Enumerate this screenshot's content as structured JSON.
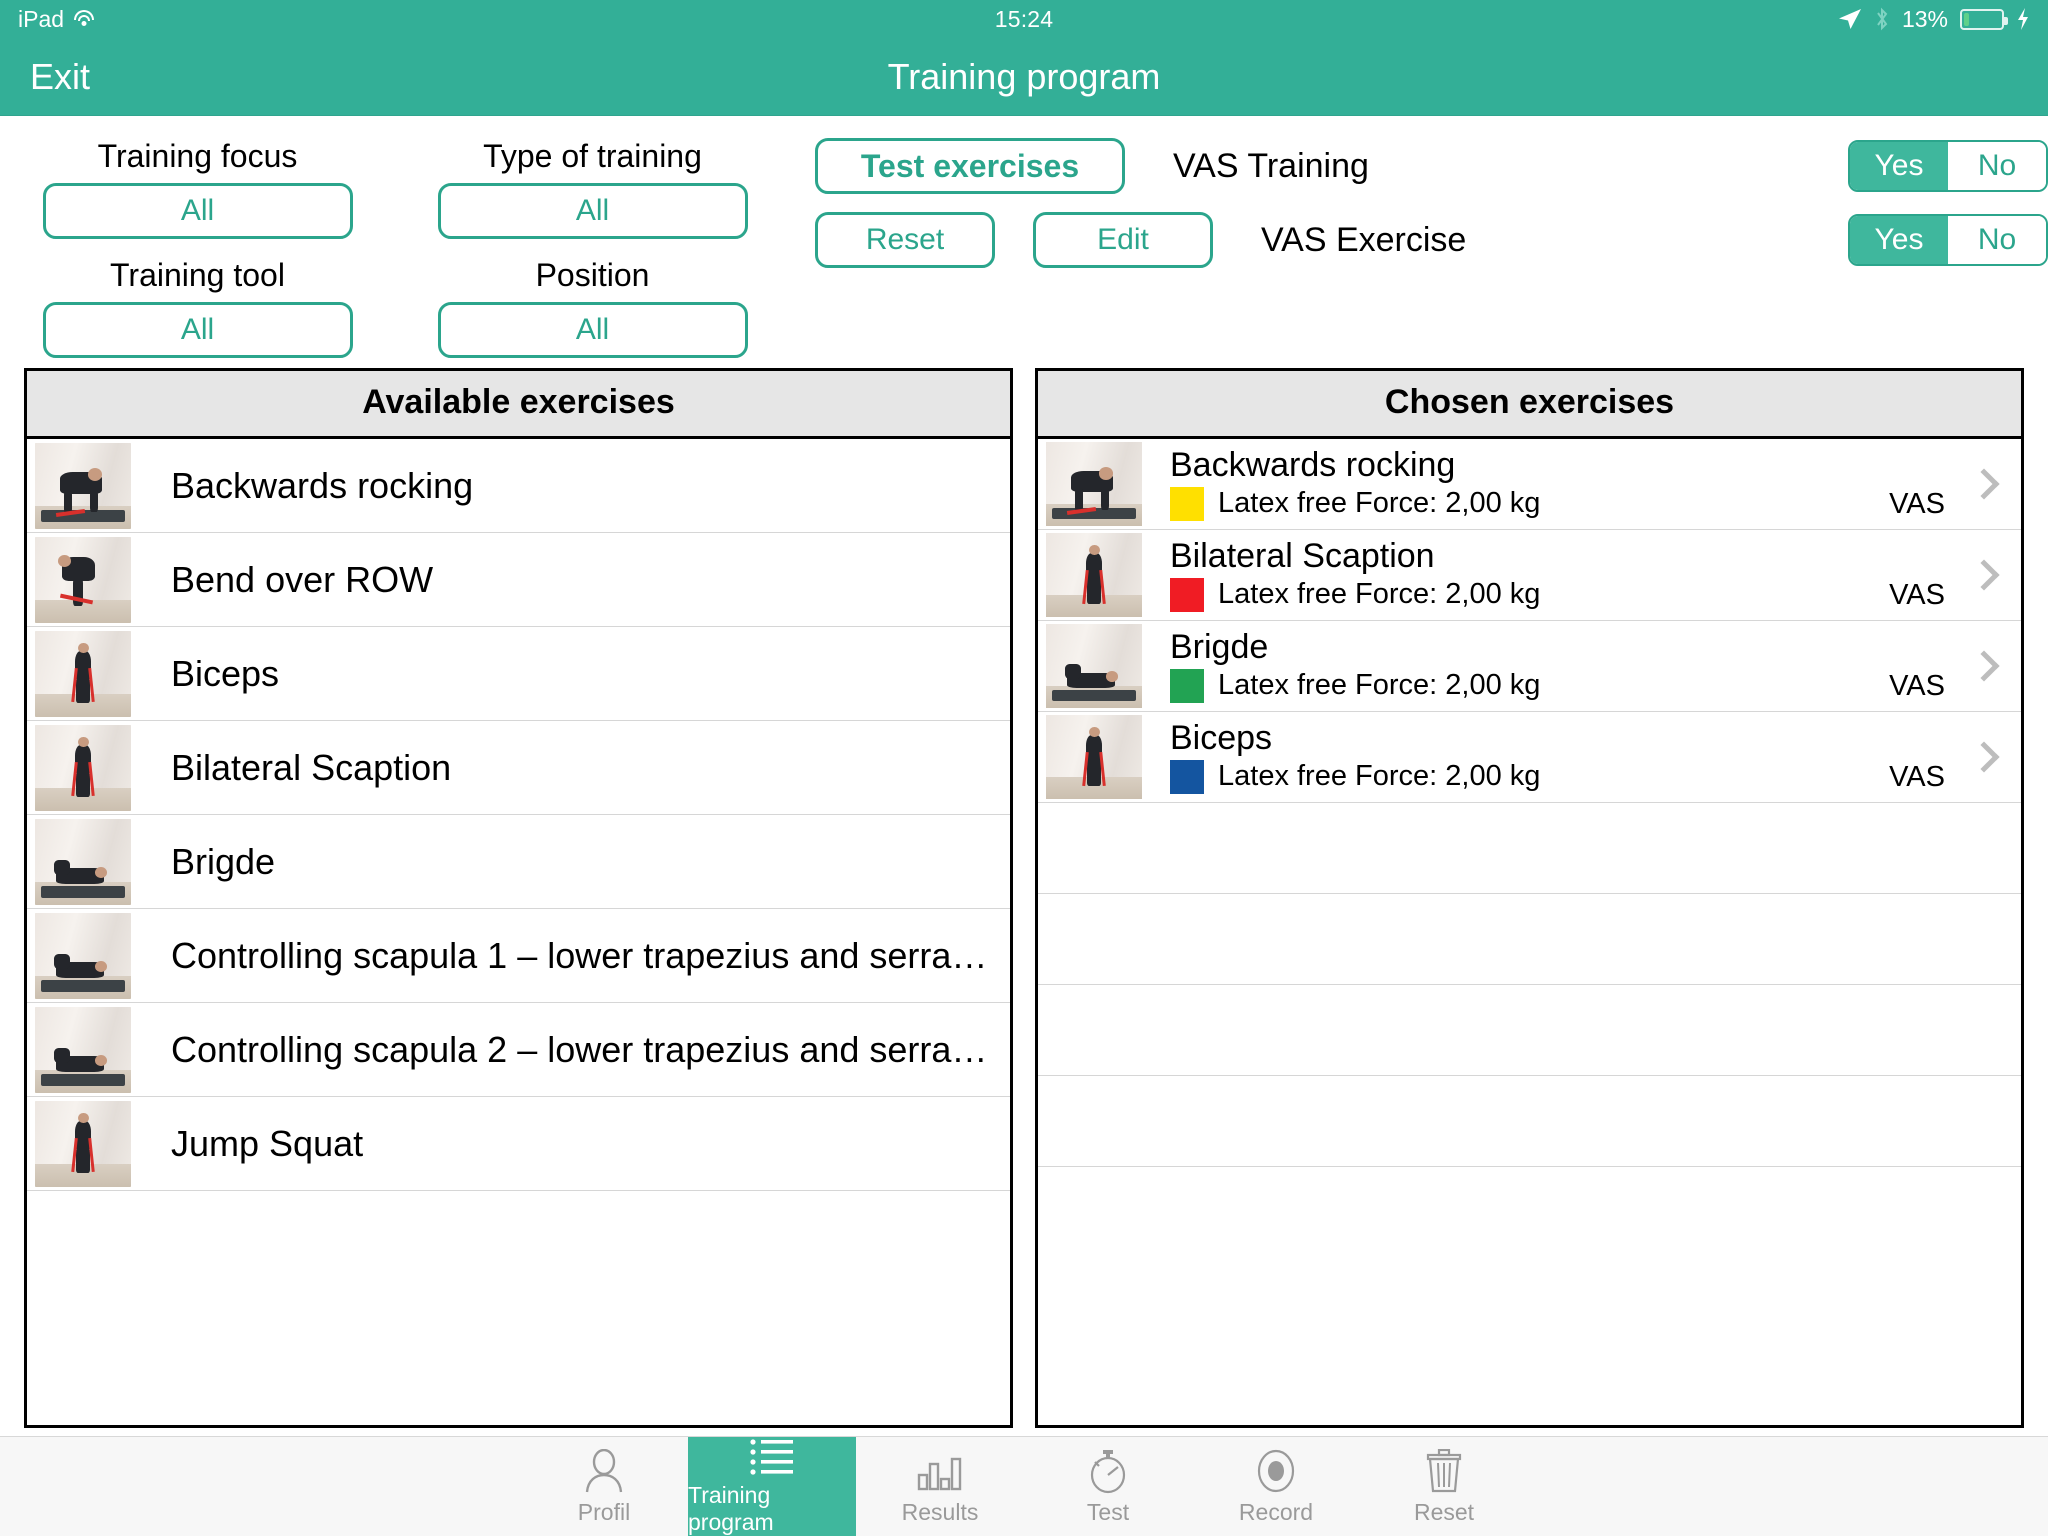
{
  "status_bar": {
    "device": "iPad",
    "wifi_icon": "wifi-icon",
    "time": "15:24",
    "location_icon": "location-arrow-icon",
    "bluetooth_icon": "bluetooth-icon",
    "battery_percent": "13%",
    "battery_level": 13,
    "battery_charging_icon": "lightning-bolt-icon",
    "battery_fill_color": "#5FD08A"
  },
  "nav": {
    "exit_label": "Exit",
    "title": "Training program",
    "background_color": "#33AF97"
  },
  "filters": {
    "cells": [
      {
        "label": "Training focus",
        "value": "All"
      },
      {
        "label": "Type of training",
        "value": "All"
      },
      {
        "label": "Training tool",
        "value": "All"
      },
      {
        "label": "Position",
        "value": "All"
      }
    ]
  },
  "actions": {
    "test_exercises_label": "Test exercises",
    "reset_label": "Reset",
    "edit_label": "Edit",
    "vas_training_label": "VAS Training",
    "vas_exercise_label": "VAS Exercise",
    "toggle_yes": "Yes",
    "toggle_no": "No",
    "vas_training_value": "Yes",
    "vas_exercise_value": "Yes",
    "accent_color": "#2BA58C"
  },
  "available_panel": {
    "title": "Available exercises",
    "items": [
      {
        "name": "Backwards rocking",
        "pose": "quadruped"
      },
      {
        "name": "Bend over ROW",
        "pose": "bentover"
      },
      {
        "name": "Biceps",
        "pose": "standing"
      },
      {
        "name": "Bilateral Scaption",
        "pose": "standing"
      },
      {
        "name": "Brigde",
        "pose": "supine"
      },
      {
        "name": "Controlling scapula 1 – lower trapezius and serra…",
        "pose": "supine"
      },
      {
        "name": "Controlling scapula 2 – lower trapezius and serra…",
        "pose": "supine"
      },
      {
        "name": "Jump Squat",
        "pose": "standing"
      }
    ]
  },
  "chosen_panel": {
    "title": "Chosen exercises",
    "vas_label": "VAS",
    "chevron_icon": "chevron-right-icon",
    "items": [
      {
        "name": "Backwards rocking",
        "detail": "Latex free Force: 2,00 kg",
        "color": "#FFE000",
        "pose": "quadruped"
      },
      {
        "name": "Bilateral Scaption",
        "detail": "Latex free Force: 2,00 kg",
        "color": "#F01C24",
        "pose": "standing"
      },
      {
        "name": "Brigde",
        "detail": "Latex free Force: 2,00 kg",
        "color": "#22A353",
        "pose": "supine"
      },
      {
        "name": "Biceps",
        "detail": "Latex free Force: 2,00 kg",
        "color": "#1455A0",
        "pose": "standing"
      }
    ],
    "empty_rows": 4
  },
  "tabbar": {
    "active_color": "#3FB79D",
    "items": [
      {
        "label": "Profil",
        "icon": "person-icon",
        "active": false
      },
      {
        "label": "Training program",
        "icon": "list-icon",
        "active": true
      },
      {
        "label": "Results",
        "icon": "bar-chart-icon",
        "active": false
      },
      {
        "label": "Test",
        "icon": "stopwatch-icon",
        "active": false
      },
      {
        "label": "Record",
        "icon": "record-icon",
        "active": false
      },
      {
        "label": "Reset",
        "icon": "trash-icon",
        "active": false
      }
    ]
  }
}
